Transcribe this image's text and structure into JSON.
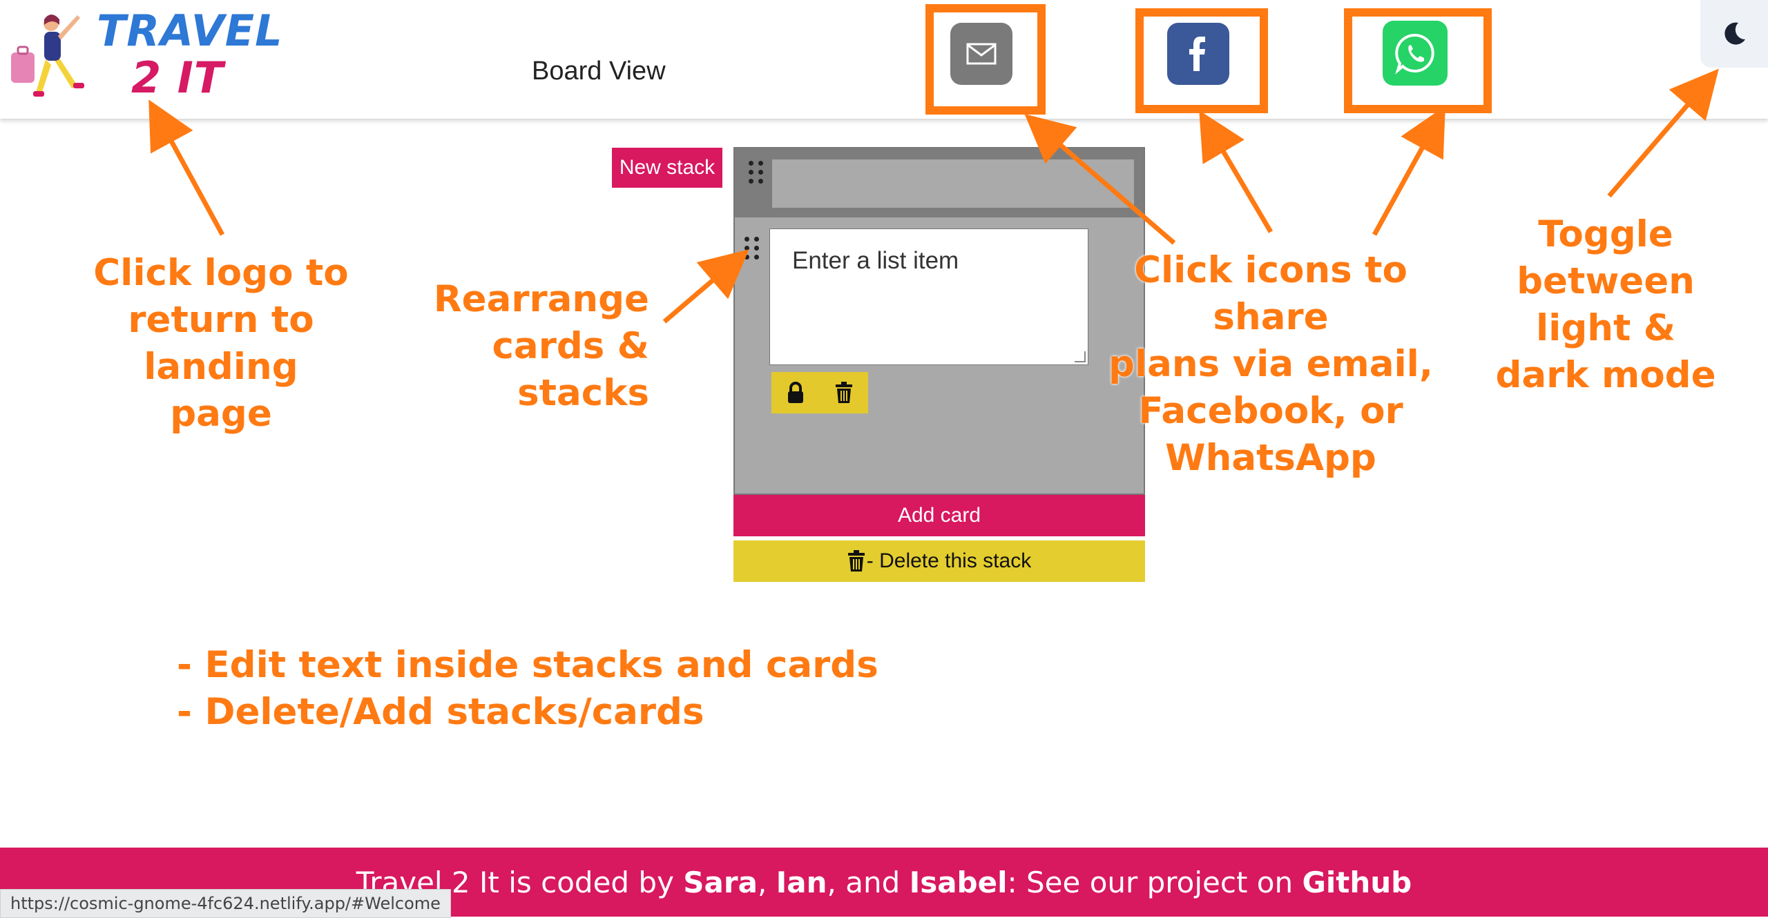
{
  "header": {
    "logo_line1": "TRAVEL",
    "logo_line2": "2 IT",
    "page_title": "Board View",
    "share": {
      "email_icon": "mail-icon",
      "facebook_icon": "facebook-icon",
      "whatsapp_icon": "whatsapp-icon"
    },
    "mode_toggle_icon": "moon-icon"
  },
  "board": {
    "new_stack_label": "New stack",
    "stack": {
      "title_value": "",
      "card": {
        "placeholder": "Enter a list item"
      }
    },
    "add_card_label": "Add card",
    "delete_stack_label": "- Delete this stack"
  },
  "annotations": {
    "logo": "Click logo to\nreturn to landing\npage",
    "rearrange": "Rearrange\ncards & stacks",
    "share": "Click icons to share\nplans via email,\nFacebook, or\nWhatsApp",
    "toggle": "Toggle\nbetween\nlight &\ndark mode",
    "edit": "- Edit text inside stacks and cards\n- Delete/Add stacks/cards"
  },
  "footer": {
    "prefix": "Travel 2 It is coded by ",
    "name1": "Sara",
    "sep1": ", ",
    "name2": "Ian",
    "sep2": ", and ",
    "name3": "Isabel",
    "middle": ": See our project on ",
    "link": "Github"
  },
  "status_url": "https://cosmic-gnome-4fc624.netlify.app/#Welcome",
  "colors": {
    "brand_pink": "#d8185f",
    "brand_yellow": "#e4cd2e",
    "annotation_orange": "#ff7a12",
    "facebook_blue": "#3b5998",
    "whatsapp_green": "#25d366",
    "email_gray": "#7a7a7a"
  }
}
